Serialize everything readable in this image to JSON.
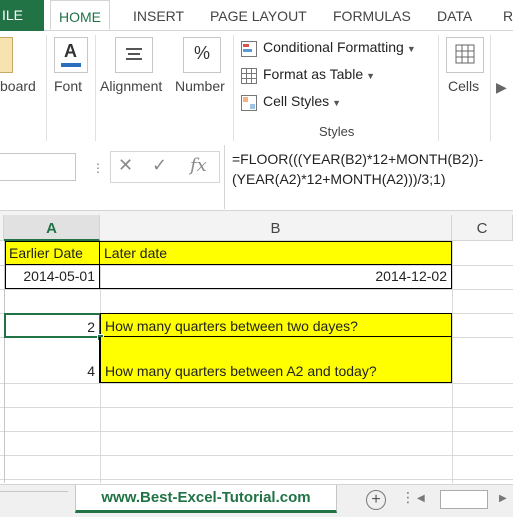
{
  "ribbon_tabs": [
    "ILE",
    "HOME",
    "INSERT",
    "PAGE LAYOUT",
    "FORMULAS",
    "DATA",
    "R"
  ],
  "ribbon": {
    "clipboard_label": "board",
    "font_label": "Font",
    "alignment_label": "Alignment",
    "number_label": "Number",
    "cells_label": "Cells",
    "styles_label": "Styles",
    "styles_items": [
      "Conditional Formatting",
      "Format as Table",
      "Cell Styles"
    ]
  },
  "formula_bar": {
    "formula_line1": "=FLOOR(((YEAR(B2)*12+MONTH(B2))-",
    "formula_line2": "(YEAR(A2)*12+MONTH(A2)))/3;1)",
    "cancel_glyph": "✕",
    "enter_glyph": "✓",
    "fx_glyph": "fx"
  },
  "columns": [
    "A",
    "B",
    "C"
  ],
  "cells": {
    "a1": "Earlier Date",
    "b1": "Later date",
    "a2": "2014-05-01",
    "b2": "2014-12-02",
    "a4": "2",
    "b4": "How many quarters between two dayes?",
    "a5": "4",
    "b5": "How many quarters between A2 and today?"
  },
  "sheet_tab": "www.Best-Excel-Tutorial.com",
  "colors": {
    "highlight": "#ffff00",
    "excel_green": "#217346"
  }
}
